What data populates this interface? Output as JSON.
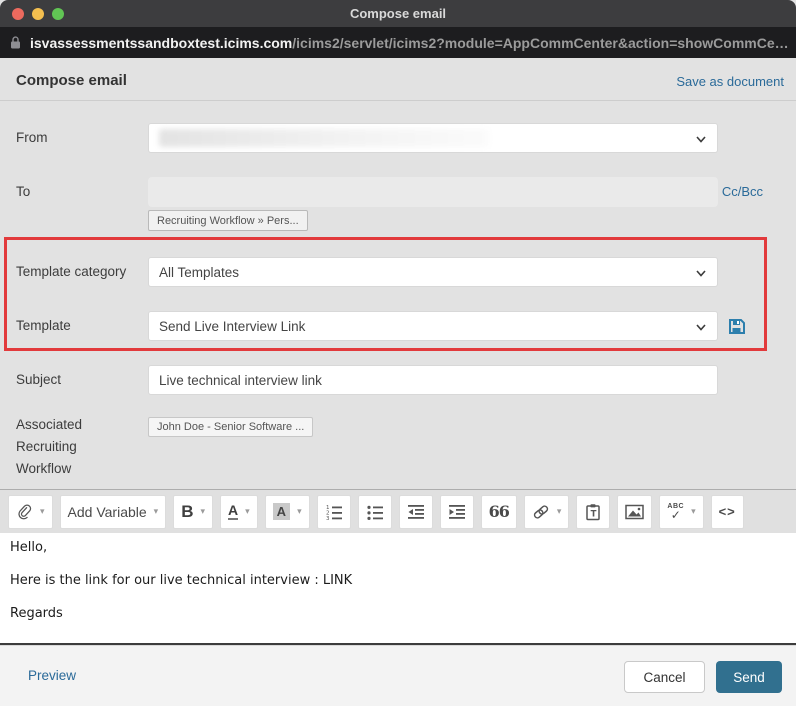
{
  "window": {
    "title": "Compose email",
    "url_domain": "isvassessmentssandboxtest.icims.com",
    "url_path": "/icims2/servlet/icims2?module=AppCommCenter&action=showCommCe…"
  },
  "header": {
    "title": "Compose email",
    "save_as_document": "Save as document"
  },
  "form": {
    "from": {
      "label": "From"
    },
    "to": {
      "label": "To",
      "cc_bcc": "Cc/Bcc",
      "tag": "Recruiting Workflow » Pers..."
    },
    "template_category": {
      "label": "Template category",
      "value": "All Templates"
    },
    "template": {
      "label": "Template",
      "value": "Send Live Interview Link"
    },
    "subject": {
      "label": "Subject",
      "value": "Live technical interview link"
    },
    "workflow": {
      "label": "Associated Recruiting Workflow",
      "tag": "John Doe - Senior Software ..."
    }
  },
  "toolbar": {
    "caret": "▾",
    "add_variable": "Add Variable",
    "bold": "B",
    "font_color": "A",
    "highlight": "A",
    "quote": "66",
    "spellcheck_text": "ABC",
    "spellcheck_check": "✓",
    "code": "<>",
    "icon_names": [
      "paperclip-icon",
      "numbered-list-icon",
      "bullet-list-icon",
      "outdent-icon",
      "indent-icon",
      "link-icon",
      "paste-as-text-icon",
      "image-icon",
      "save-template-icon",
      "lock-icon"
    ]
  },
  "editor": {
    "lines": [
      "Hello,",
      "Here is the link for our live technical interview : LINK",
      "Regards"
    ]
  },
  "footer": {
    "preview": "Preview",
    "cancel": "Cancel",
    "send": "Send"
  },
  "colors": {
    "accent_link": "#2a6a99",
    "send_button": "#31708f",
    "highlight_box": "#e23a3c",
    "save_icon": "#2d7fad",
    "titlebar": "#3d3d3f",
    "urlbar": "#1d1d1f",
    "page_bg": "#e2e2e2"
  }
}
